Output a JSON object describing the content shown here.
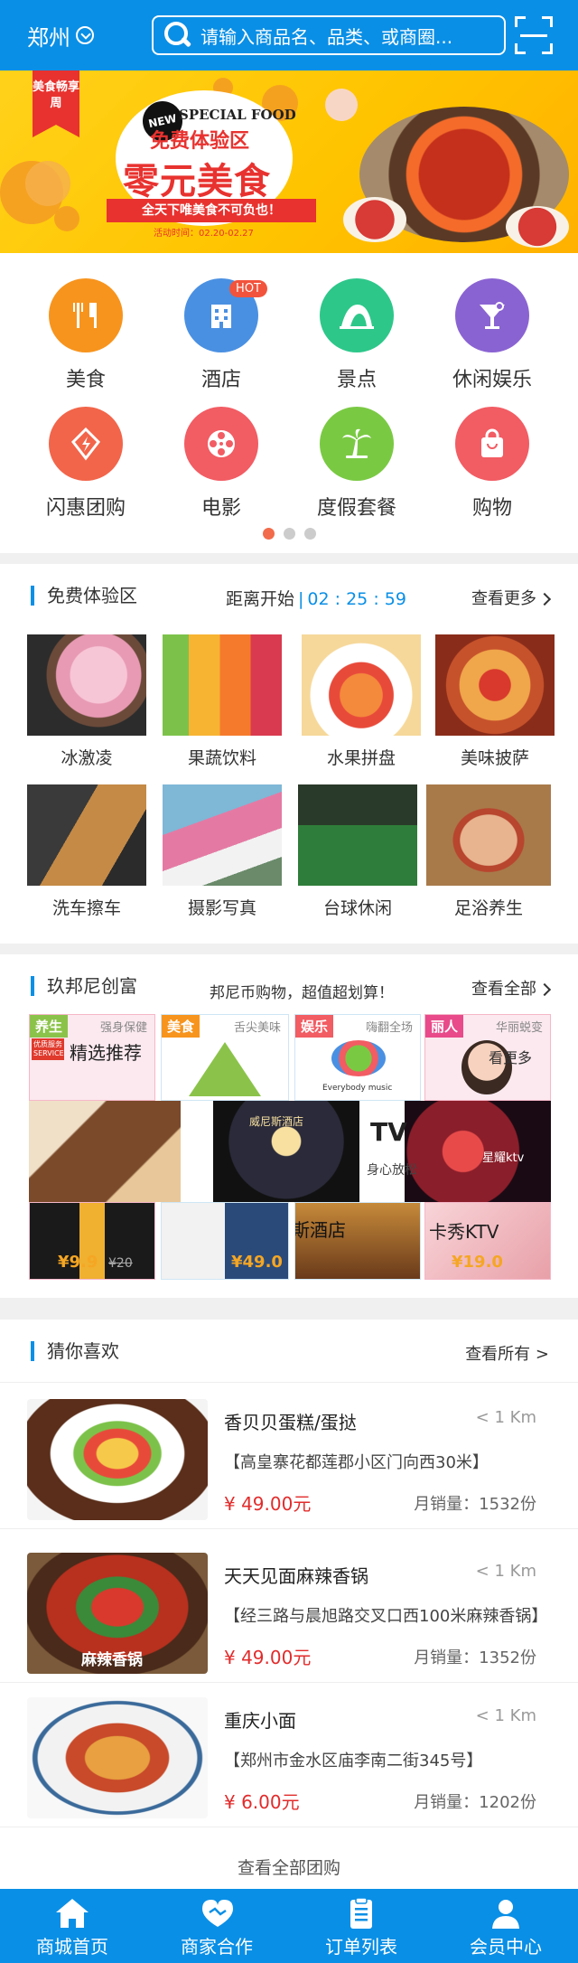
{
  "header": {
    "city": "郑州",
    "search_placeholder": "请输入商品名、品类、或商圈..."
  },
  "banner": {
    "ribbon": "美食畅享周",
    "badge": "NEW",
    "special": "SPECIAL FOOD",
    "free_zone": "免费体验区",
    "headline": "零元美食",
    "slogan": "全天下唯美食不可负也！",
    "period": "活动时间：02.20-02.27"
  },
  "categories": [
    {
      "label": "美食",
      "color": "#f7941d",
      "icon": "fork-knife-icon"
    },
    {
      "label": "酒店",
      "color": "#4a90e2",
      "icon": "hotel-icon",
      "badge": "HOT"
    },
    {
      "label": "景点",
      "color": "#2dc78a",
      "icon": "landmark-icon"
    },
    {
      "label": "休闲娱乐",
      "color": "#8a63d2",
      "icon": "cocktail-icon"
    },
    {
      "label": "闪惠团购",
      "color": "#f2654a",
      "icon": "tag-icon"
    },
    {
      "label": "电影",
      "color": "#f25c63",
      "icon": "film-reel-icon"
    },
    {
      "label": "度假套餐",
      "color": "#7ac943",
      "icon": "palm-tree-icon"
    },
    {
      "label": "购物",
      "color": "#f25c63",
      "icon": "shopping-bag-icon"
    }
  ],
  "free_trial": {
    "title": "免费体验区",
    "countdown_label": "距离开始",
    "time": {
      "h": "02",
      "m": "25",
      "s": "59"
    },
    "more": "查看更多",
    "items": [
      "冰激凌",
      "果蔬饮料",
      "水果拼盘",
      "美味披萨",
      "洗车擦车",
      "摄影写真",
      "台球休闲",
      "足浴养生"
    ]
  },
  "jiubang": {
    "title": "玖邦尼创富",
    "tagline": "邦尼币购物，超值超划算！",
    "more": "查看全部",
    "tiles": {
      "t1": {
        "tag": "养生",
        "sub": "强身保健",
        "title": "精选推荐",
        "badge": "优质服务 SERVICE"
      },
      "t2": {
        "tag": "美食",
        "sub": "舌尖美味"
      },
      "t3": {
        "tag": "娱乐",
        "sub": "嗨翻全场",
        "caption": "Everybody music"
      },
      "t4": {
        "tag": "丽人",
        "sub": "华丽蜕变",
        "more": "看更多"
      },
      "hotel_sign": "威尼斯酒店",
      "hotel_cn": "威尼斯酒店",
      "ktv_name": "星耀ktv",
      "ktv2": "卡秀KTV",
      "mid_text": "身心放松",
      "mid_text2": "TV",
      "price1": "¥9.9",
      "price1_old": "¥20",
      "price2": "¥49.0",
      "price3": "¥19.0"
    }
  },
  "guess": {
    "title": "猜你喜欢",
    "more": "查看所有 >",
    "items": [
      {
        "name": "香贝贝蛋糕/蛋挞",
        "distance": "< 1 Km",
        "address": "【高皇寨花都莲郡小区门向西30米】",
        "price": "¥ 49.00元",
        "sold": "月销量：1532份"
      },
      {
        "name": "天天见面麻辣香锅",
        "distance": "< 1 Km",
        "address": "【经三路与晨旭路交叉口西100米麻辣香锅】",
        "price": "¥ 49.00元",
        "sold": "月销量：1352份",
        "pic_text": "麻辣香锅"
      },
      {
        "name": "重庆小面",
        "distance": "< 1 Km",
        "address": "【郑州市金水区庙李南二街345号】",
        "price": "¥ 6.00元",
        "sold": "月销量：1202份"
      }
    ],
    "all": "查看全部团购"
  },
  "tabbar": [
    {
      "label": "商城首页",
      "icon": "home-icon"
    },
    {
      "label": "商家合作",
      "icon": "handshake-icon"
    },
    {
      "label": "订单列表",
      "icon": "clipboard-list-icon"
    },
    {
      "label": "会员中心",
      "icon": "user-icon"
    }
  ]
}
